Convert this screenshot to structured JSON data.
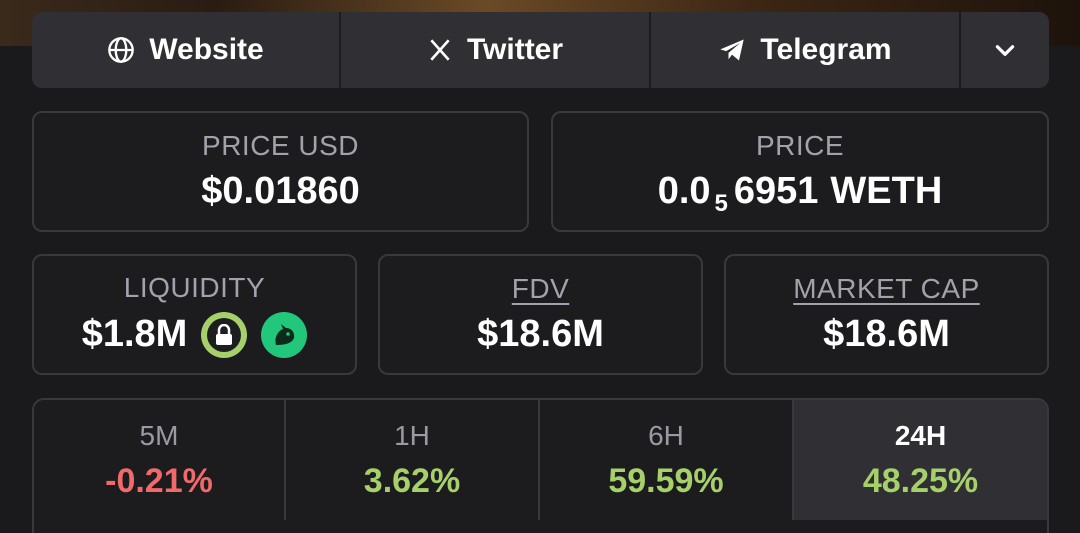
{
  "links": {
    "website": "Website",
    "twitter": "Twitter",
    "telegram": "Telegram"
  },
  "price_usd": {
    "label": "PRICE USD",
    "value": "$0.01860"
  },
  "price": {
    "label": "PRICE",
    "prefix": "0.0",
    "subscript": "5",
    "digits": "6951",
    "unit": "WETH"
  },
  "liquidity": {
    "label": "LIQUIDITY",
    "value": "$1.8M"
  },
  "fdv": {
    "label": "FDV",
    "value": "$18.6M"
  },
  "market_cap": {
    "label": "MARKET CAP",
    "value": "$18.6M"
  },
  "timeframes": [
    {
      "label": "5M",
      "change": "-0.21%"
    },
    {
      "label": "1H",
      "change": "3.62%"
    },
    {
      "label": "6H",
      "change": "59.59%"
    },
    {
      "label": "24H",
      "change": "48.25%"
    }
  ],
  "selected_timeframe": "24H",
  "colors": {
    "negative": "#f06a6a",
    "positive": "#a6d16a",
    "card_bg": "#1c1c1f",
    "bar_bg": "#2f2f34"
  }
}
